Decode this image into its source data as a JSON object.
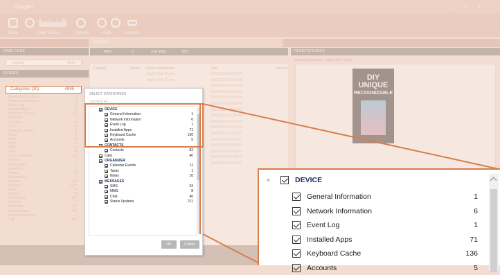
{
  "window": {
    "title": "Oxygen",
    "controls": [
      "_",
      "□",
      "×"
    ]
  },
  "ribbon": {
    "search_value": "AFD-MLB6",
    "menu": [
      "Case",
      "Time Zones",
      "Options",
      "Help",
      "License"
    ]
  },
  "tabs": {
    "active": "Spotlight"
  },
  "left": {
    "case_files_header": "CASE FILES",
    "logical_label": "Logical",
    "logical_count": "4895",
    "filters_header": "FILTERS",
    "categories_label": "Categories (30)",
    "categories_count": "4895",
    "faded_categories": [
      {
        "name": "General Information",
        "count": "1"
      },
      {
        "name": "Network Information",
        "count": "6"
      },
      {
        "name": "Event Log",
        "count": "1"
      },
      {
        "name": "Installed Apps",
        "count": "71"
      },
      {
        "name": "Keyboard Cache",
        "count": "136"
      },
      {
        "name": "Accounts",
        "count": "5"
      },
      {
        "name": "Contacts",
        "count": "82"
      },
      {
        "name": "Calls",
        "count": "40"
      },
      {
        "name": "Calendar Events",
        "count": "11"
      },
      {
        "name": "Tasks",
        "count": "1"
      },
      {
        "name": "Notes",
        "count": "10"
      },
      {
        "name": "SMS",
        "count": "53"
      },
      {
        "name": "MMS",
        "count": "8"
      },
      {
        "name": "Chat",
        "count": "46"
      },
      {
        "name": "Status Updates",
        "count": "211"
      },
      {
        "name": "History",
        "count": "3"
      },
      {
        "name": "Bookmarks",
        "count": "6"
      },
      {
        "name": "Searches",
        "count": "1"
      },
      {
        "name": "History",
        "count": "10"
      },
      {
        "name": "Bookmarks",
        "count": "3"
      },
      {
        "name": "Cookies",
        "count": "118"
      },
      {
        "name": "Pictures",
        "count": "2050"
      },
      {
        "name": "Audio",
        "count": "84"
      },
      {
        "name": "Videos",
        "count": "37"
      },
      {
        "name": "Documents",
        "count": "804"
      },
      {
        "name": "Archives",
        "count": "1"
      },
      {
        "name": "Databases",
        "count": "122"
      },
      {
        "name": "Unrecognized",
        "count": "316"
      },
      {
        "name": "Device Statement",
        "count": "1"
      },
      {
        "name": "Log",
        "count": "480"
      }
    ]
  },
  "grid": {
    "toolbar": [
      "4895",
      "0",
      "Grid 4895",
      "1811"
    ],
    "columns": [
      "Category",
      "Viewer",
      "Related Application",
      "Time",
      "Deleted"
    ],
    "rows": [
      {
        "app": "Apple Web Cache",
        "time": "25/02/2014 16:08:56"
      },
      {
        "app": "Apple Web Cache",
        "time": "25/02/2014 16:08:56"
      },
      {
        "app": "",
        "time": "25/02/2014 16:08:56"
      },
      {
        "app": "",
        "time": "25/02/2014 16:08:56"
      },
      {
        "app": "",
        "time": "25/02/2014 16:08:56"
      },
      {
        "app": "",
        "time": "25/02/2014 16:18:41"
      },
      {
        "app": "",
        "time": "25/02/2014 16:18:41"
      },
      {
        "app": "",
        "time": "25/02/2014 16:18:41"
      },
      {
        "app": "",
        "time": "25/02/2014 16:18:41"
      },
      {
        "app": "",
        "time": "25/02/2014 16:18:41"
      },
      {
        "app": "",
        "time": "25/02/2014 16:18:41"
      },
      {
        "app": "",
        "time": "25/02/2014 16:18:41"
      },
      {
        "app": "",
        "time": "25/02/2014 16:18:41"
      },
      {
        "app": "",
        "time": "25/02/2014 16:18:41"
      },
      {
        "app": "",
        "time": "25/02/2014 16:18:41"
      },
      {
        "app": "",
        "time": "25/02/2014 16:18:41"
      }
    ]
  },
  "right": {
    "header": "FILES/PICTURES",
    "related_app_label": "Related Application: Apple Web Cache",
    "ad_text": [
      "DIY",
      "UNIQUE",
      "RECOGNIZABLE"
    ]
  },
  "dialog": {
    "title": "SELECT CATEGORIES",
    "uncheck_all": "Uncheck All",
    "groups": [
      {
        "name": "DEVICE",
        "items": [
          {
            "name": "General Information",
            "count": "1"
          },
          {
            "name": "Network Information",
            "count": "6"
          },
          {
            "name": "Event Log",
            "count": "1"
          },
          {
            "name": "Installed Apps",
            "count": "71"
          },
          {
            "name": "Keyboard Cache",
            "count": "136"
          },
          {
            "name": "Accounts",
            "count": "5"
          }
        ]
      },
      {
        "name": "CONTACTS",
        "items": [
          {
            "name": "Contacts",
            "count": "82"
          }
        ]
      },
      {
        "name": "Calls",
        "count": "40",
        "leaf": true
      },
      {
        "name": "ORGANIZER",
        "items": [
          {
            "name": "Calendar Events",
            "count": "11"
          },
          {
            "name": "Tasks",
            "count": "1"
          },
          {
            "name": "Notes",
            "count": "10"
          }
        ]
      },
      {
        "name": "MESSAGES",
        "items": [
          {
            "name": "SMS",
            "count": "53"
          },
          {
            "name": "MMS",
            "count": "8"
          },
          {
            "name": "Chat",
            "count": "46"
          },
          {
            "name": "Status Updates",
            "count": "211"
          }
        ]
      }
    ],
    "ok_label": "OK",
    "cancel_label": "Cancel"
  },
  "zoom": {
    "group": "DEVICE",
    "items": [
      {
        "name": "General Information",
        "count": "1"
      },
      {
        "name": "Network Information",
        "count": "6"
      },
      {
        "name": "Event Log",
        "count": "1"
      },
      {
        "name": "Installed Apps",
        "count": "71"
      },
      {
        "name": "Keyboard Cache",
        "count": "136"
      },
      {
        "name": "Accounts",
        "count": "5"
      }
    ]
  },
  "colors": {
    "accent": "#e07b45",
    "group_text": "#17316b"
  }
}
